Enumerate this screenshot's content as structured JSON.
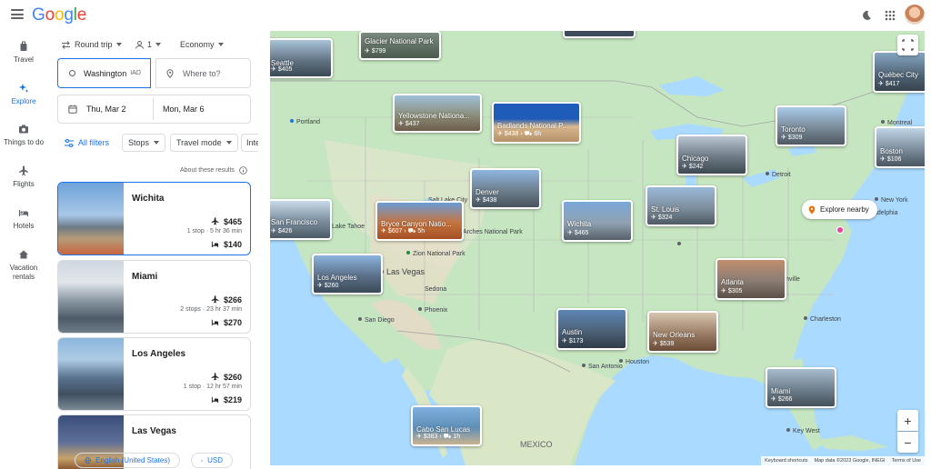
{
  "brand": "Google",
  "rail": [
    {
      "id": "travel",
      "label": "Travel"
    },
    {
      "id": "explore",
      "label": "Explore",
      "active": true
    },
    {
      "id": "things",
      "label": "Things to do"
    },
    {
      "id": "flights",
      "label": "Flights"
    },
    {
      "id": "hotels",
      "label": "Hotels"
    },
    {
      "id": "vacation",
      "label": "Vacation rentals"
    }
  ],
  "search": {
    "trip_type": "Round trip",
    "passengers": "1",
    "cabin": "Economy",
    "origin": "Washington",
    "origin_code": "IAD",
    "destination_placeholder": "Where to?",
    "depart": "Thu, Mar 2",
    "return": "Mon, Mar 6"
  },
  "filters": {
    "all": "All filters",
    "stops": "Stops",
    "travel_mode": "Travel mode",
    "more": "Inte"
  },
  "about_results": "About these results",
  "results": [
    {
      "city": "Wichita",
      "flight_price": "$465",
      "flight_details": "1 stop · 5 hr 36 min",
      "hotel_price": "$140"
    },
    {
      "city": "Miami",
      "flight_price": "$266",
      "flight_details": "2 stops · 23 hr 37 min",
      "hotel_price": "$270"
    },
    {
      "city": "Los Angeles",
      "flight_price": "$260",
      "flight_details": "1 stop · 12 hr 57 min",
      "hotel_price": "$219"
    },
    {
      "city": "Las Vegas"
    }
  ],
  "footer": {
    "language": "English (United States)",
    "currency": "USD"
  },
  "map": {
    "destinations": [
      {
        "name": "Seattle",
        "price": "$405"
      },
      {
        "name": "Glacier National Park",
        "price": "$799"
      },
      {
        "name": "Yellowstone Nationa...",
        "price": "$437"
      },
      {
        "name": "Badlands National P...",
        "price": "$438",
        "duration": "6h"
      },
      {
        "name": "Denver",
        "price": "$438"
      },
      {
        "name": "San Francisco",
        "price": "$426"
      },
      {
        "name": "Bryce Canyon Natio...",
        "price": "$607",
        "duration": "5h"
      },
      {
        "name": "Los Angeles",
        "price": "$260"
      },
      {
        "name": "Wichita",
        "price": "$465"
      },
      {
        "name": "Chicago",
        "price": "$242"
      },
      {
        "name": "St. Louis",
        "price": "$324"
      },
      {
        "name": "Toronto",
        "price": "$309"
      },
      {
        "name": "Québec City",
        "price": "$417"
      },
      {
        "name": "Boston",
        "price": "$106"
      },
      {
        "name": "Atlanta",
        "price": "$305"
      },
      {
        "name": "Austin",
        "price": "$173"
      },
      {
        "name": "New Orleans",
        "price": "$539"
      },
      {
        "name": "Miami",
        "price": "$266"
      },
      {
        "name": "Cabo San Lucas",
        "price": "$383",
        "duration": "1h"
      }
    ],
    "labels": [
      "Portland",
      "Salt Lake City",
      "Lake Tahoe",
      "Zion National Park",
      "Arches National Park",
      "Las Vegas",
      "Sedona",
      "Phoenix",
      "San Diego",
      "San Antonio",
      "Houston",
      "Charleston",
      "Detroit",
      "Montreal",
      "New York",
      "adelphia",
      "nville",
      "Key West",
      "MEXICO"
    ],
    "explore_nearby": "Explore nearby",
    "zoom_in": "+",
    "zoom_out": "−",
    "attribution": [
      "Keyboard shortcuts",
      "Map data ©2023 Google, INEGI",
      "Terms of Use"
    ]
  }
}
